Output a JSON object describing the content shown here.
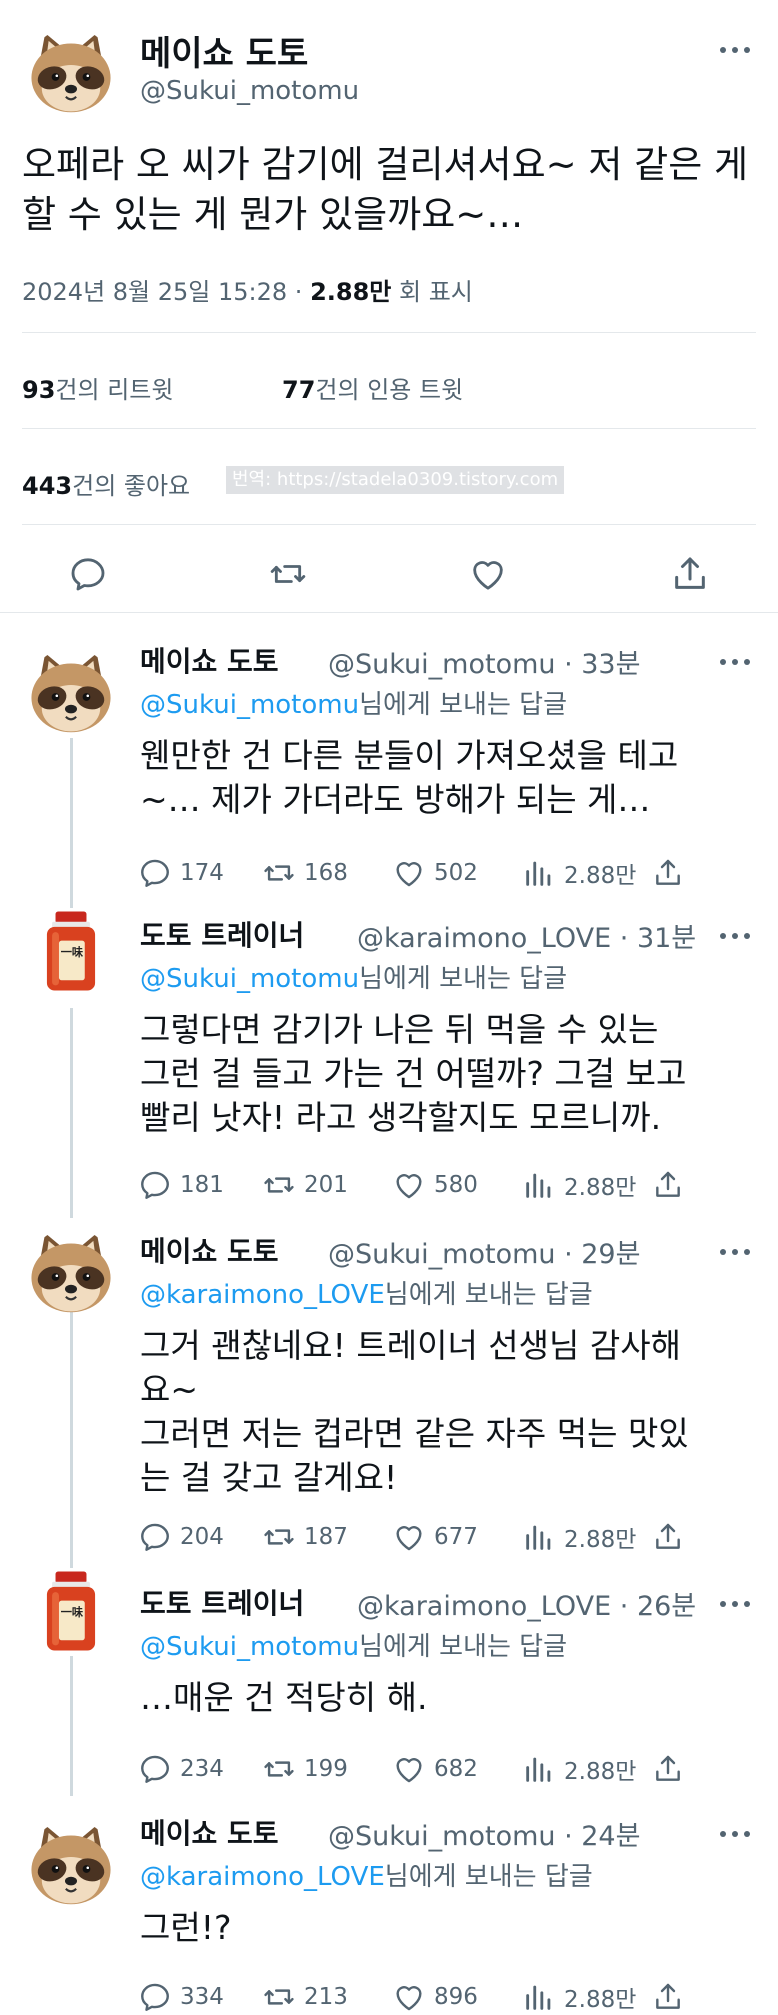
{
  "main_tweet": {
    "author_name": "메이쇼 도토",
    "author_handle": "@Sukui_motomu",
    "text": "오페라 오 씨가 감기에 걸리셔서요~ 저 같은 게 할 수 있는 게 뭔가 있을까요~…",
    "date": "2024년 8월 25일  15:28 · ",
    "views_count": "2.88만",
    "views_label": " 회 표시",
    "retweets_count": "93",
    "retweets_label": "건의 리트윗",
    "quotes_count": "77",
    "quotes_label": "건의 인용 트윗",
    "likes_count": "443",
    "likes_label": "건의 좋아요",
    "watermark": "번역: https://stadela0309.tistory.com"
  },
  "replies": [
    {
      "author_name": "메이쇼 도토",
      "author_handle": "@Sukui_motomu · 33분",
      "reply_to_handle": "@Sukui_motomu",
      "reply_to_suffix": "님에게 보내는 답글",
      "text": "웬만한 건 다른 분들이 가져오셨을 테고\n~… 제가 가더라도 방해가 되는 게…",
      "replies": "174",
      "retweets": "168",
      "likes": "502",
      "views": "2.88만",
      "avatar": "raccoon-dog-icon"
    },
    {
      "author_name": "도토 트레이너",
      "author_handle": "@karaimono_LOVE · 31분",
      "reply_to_handle": "@Sukui_motomu",
      "reply_to_suffix": "님에게 보내는 답글",
      "text": "그렇다면 감기가 나은 뒤 먹을 수 있는\n그런 걸 들고 가는 건 어떨까? 그걸 보고\n빨리 낫자! 라고 생각할지도 모르니까.",
      "replies": "181",
      "retweets": "201",
      "likes": "580",
      "views": "2.88만",
      "avatar": "spice-jar-icon"
    },
    {
      "author_name": "메이쇼 도토",
      "author_handle": "@Sukui_motomu · 29분",
      "reply_to_handle": "@karaimono_LOVE",
      "reply_to_suffix": "님에게 보내는 답글",
      "text": "그거 괜찮네요! 트레이너 선생님 감사해\n요~\n그러면 저는 컵라면 같은 자주 먹는 맛있\n는 걸 갖고 갈게요!",
      "replies": "204",
      "retweets": "187",
      "likes": "677",
      "views": "2.88만",
      "avatar": "raccoon-dog-icon"
    },
    {
      "author_name": "도토 트레이너",
      "author_handle": "@karaimono_LOVE · 26분",
      "reply_to_handle": "@Sukui_motomu",
      "reply_to_suffix": "님에게 보내는 답글",
      "text": "…매운 건 적당히 해.",
      "replies": "234",
      "retweets": "199",
      "likes": "682",
      "views": "2.88만",
      "avatar": "spice-jar-icon"
    },
    {
      "author_name": "메이쇼 도토",
      "author_handle": "@Sukui_motomu · 24분",
      "reply_to_handle": "@karaimono_LOVE",
      "reply_to_suffix": "님에게 보내는 답글",
      "text": "그런!?",
      "replies": "334",
      "retweets": "213",
      "likes": "896",
      "views": "2.88만",
      "avatar": "raccoon-dog-icon"
    }
  ],
  "spice_jar_label": "一味",
  "colors": {
    "text": "#0f1419",
    "secondary": "#536471",
    "link": "#1d9bf0",
    "divider": "#e4e8eb"
  }
}
